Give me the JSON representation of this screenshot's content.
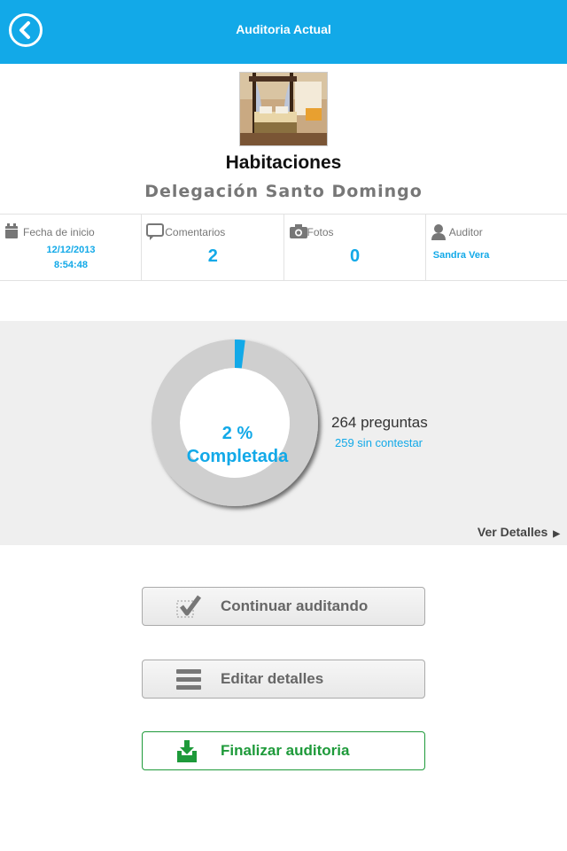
{
  "header": {
    "title": "Auditoria Actual",
    "back_icon": "chevron-left-icon"
  },
  "area": {
    "title": "Habitaciones",
    "subtitle": "Delegación Santo Domingo"
  },
  "stats": {
    "fecha": {
      "label": "Fecha de inicio",
      "date": "12/12/2013",
      "time": "8:54:48",
      "icon": "calendar-icon"
    },
    "comentarios": {
      "label": "Comentarios",
      "value": "2",
      "icon": "comment-icon"
    },
    "fotos": {
      "label": "Fotos",
      "value": "0",
      "icon": "camera-icon"
    },
    "auditor": {
      "label": "Auditor",
      "value": "Sandra Vera",
      "icon": "user-icon"
    }
  },
  "progress": {
    "percent": 2,
    "percent_text": "2 %",
    "completed_label": "Completada",
    "preguntas": "264 preguntas",
    "sin_contestar": "259 sin contestar",
    "ver_detalles": "Ver Detalles"
  },
  "actions": {
    "continuar": "Continuar auditando",
    "editar": "Editar detalles",
    "finalizar": "Finalizar auditoria"
  },
  "colors": {
    "accent": "#12a9e8",
    "success": "#1e9a3a",
    "panel": "#efefef"
  }
}
